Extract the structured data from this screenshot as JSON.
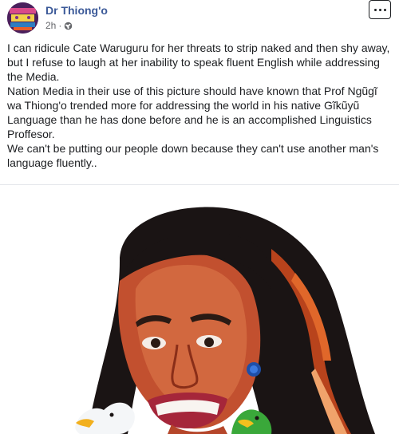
{
  "post": {
    "author": "Dr Thiong'o",
    "time": "2h",
    "separator": "·",
    "paragraphs": [
      "I can ridicule Cate Waruguru for her threats to strip naked and then shy away, but I refuse to laugh at her inability to speak fluent English while addressing the Media.",
      "Nation Media in their use of this picture should have known that Prof Ngũgĩ wa Thiong'o trended more for addressing the world in his native Gĩkũyũ Language than he has done before and he is an accomplished Linguistics Proffesor.",
      "We can't be putting our people down because they can't use another man's language fluently.."
    ]
  },
  "icons": {
    "privacy": "globe-icon",
    "menu": "more-options-icon"
  }
}
